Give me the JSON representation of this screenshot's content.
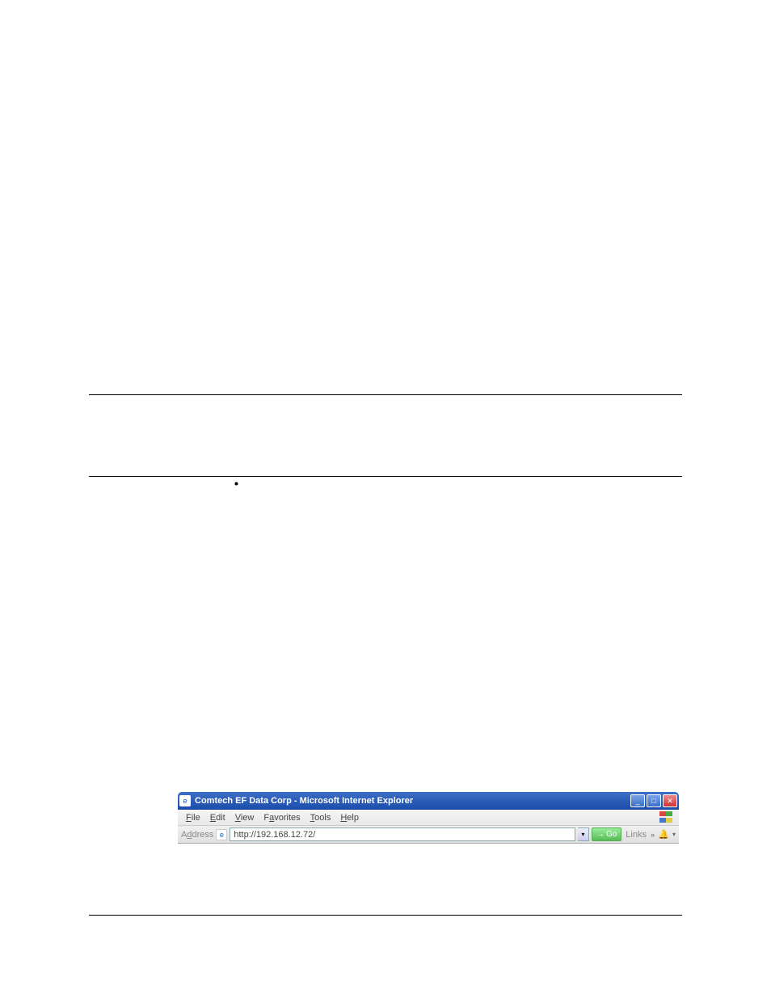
{
  "browser": {
    "title": "Comtech EF Data Corp - Microsoft Internet Explorer",
    "menu": {
      "file": "File",
      "edit": "Edit",
      "view": "View",
      "favorites": "Favorites",
      "tools": "Tools",
      "help": "Help"
    },
    "address_label": "Address",
    "url": "http://192.168.12.72/",
    "go_label": "Go",
    "links_label": "Links",
    "links_chevron": "»"
  }
}
